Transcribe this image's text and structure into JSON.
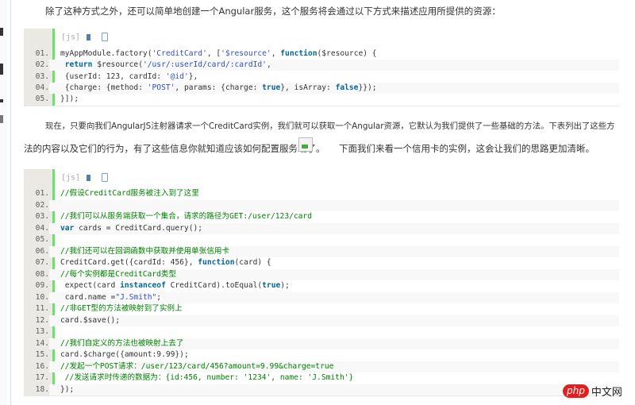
{
  "paragraphs": {
    "intro": "除了这种方式之外，还可以简单地创建一个Angular服务，这个服务将会通过以下方式来描述应用所提供的资源：",
    "second_line1": "现在，只要向我们AngularJS注射器请求一个CreditCard实例，我们就可以获取一个Angular资源，它默认为我们提供了一些基础的方法。下表列出了这些方",
    "second_line2a": "法的内容以及它们的行为，有了这些信息你就知道应该如何配置服务端了。",
    "second_line2b": "下面我们来看一个信用卡的实例，这会让我们的思路更加清晰。"
  },
  "code_blocks": [
    {
      "lang_label": "[js]",
      "lines": [
        {
          "n": "01.",
          "tokens": [
            [
              "",
              "myAppModule.factory("
            ],
            [
              "s",
              "'CreditCard'"
            ],
            [
              "",
              ", ["
            ],
            [
              "s",
              "'$resource'"
            ],
            [
              "",
              ", "
            ],
            [
              "k",
              "function"
            ],
            [
              "",
              "($resource) {"
            ]
          ]
        },
        {
          "n": "02.",
          "tokens": [
            [
              "",
              " "
            ],
            [
              "k",
              "return"
            ],
            [
              "",
              " $resource("
            ],
            [
              "s",
              "'/usr/:userId/card/:cardId'"
            ],
            [
              "",
              ","
            ]
          ]
        },
        {
          "n": "03.",
          "tokens": [
            [
              "",
              "",
              " "
            ],
            [
              "",
              ""
            ],
            [
              "",
              "{userId: 123, cardId: "
            ],
            [
              "s",
              "'@id'"
            ],
            [
              "",
              "},"
            ]
          ]
        },
        {
          "n": "04.",
          "tokens": [
            [
              "",
              "",
              " "
            ],
            [
              "",
              "{charge: {method: "
            ],
            [
              "s",
              "'POST'"
            ],
            [
              "",
              ", params: {charge: "
            ],
            [
              "k",
              "true"
            ],
            [
              "",
              "}, isArray: "
            ],
            [
              "k",
              "false"
            ],
            [
              "",
              "}});"
            ]
          ]
        },
        {
          "n": "05.",
          "tokens": [
            [
              "",
              "}]);"
            ]
          ]
        }
      ]
    },
    {
      "lang_label": "[js]",
      "lines": [
        {
          "n": "01.",
          "tokens": [
            [
              "c",
              "//假设CreditCard服务被注入到了这里"
            ]
          ]
        },
        {
          "n": "02.",
          "tokens": []
        },
        {
          "n": "03.",
          "tokens": [
            [
              "c",
              "//我们可以从服务端获取一个集合，请求的路径为GET:/user/123/card"
            ]
          ]
        },
        {
          "n": "04.",
          "tokens": [
            [
              "k",
              "var"
            ],
            [
              "",
              " cards = CreditCard.query();"
            ]
          ]
        },
        {
          "n": "05.",
          "tokens": []
        },
        {
          "n": "06.",
          "tokens": [
            [
              "c",
              "//我们还可以在回调函数中获取并使用单张信用卡"
            ]
          ]
        },
        {
          "n": "07.",
          "tokens": [
            [
              "",
              "CreditCard.get({cardId: 456}, "
            ],
            [
              "k",
              "function"
            ],
            [
              "",
              "(card) {"
            ]
          ]
        },
        {
          "n": "08.",
          "tokens": [
            [
              "c",
              "//每个实例都是CreditCard类型"
            ]
          ]
        },
        {
          "n": "09.",
          "tokens": [
            [
              "",
              " expect(card "
            ],
            [
              "k",
              "instanceof"
            ],
            [
              "",
              " CreditCard).toEqual("
            ],
            [
              "k",
              "true"
            ],
            [
              "",
              ");"
            ]
          ]
        },
        {
          "n": "10.",
          "tokens": [
            [
              "",
              " card.name ="
            ],
            [
              "s",
              "\"J.Smith\""
            ],
            [
              "",
              ";"
            ]
          ]
        },
        {
          "n": "11.",
          "tokens": [
            [
              "c",
              "//非GET型的方法被映射到了实例上"
            ]
          ]
        },
        {
          "n": "12.",
          "tokens": [
            [
              "",
              "card.$save();"
            ]
          ]
        },
        {
          "n": "13.",
          "tokens": []
        },
        {
          "n": "14.",
          "tokens": [
            [
              "c",
              "//我们自定义的方法也被映射上去了"
            ]
          ]
        },
        {
          "n": "15.",
          "tokens": [
            [
              "",
              "card.$charge({amount:9.99});"
            ]
          ]
        },
        {
          "n": "16.",
          "tokens": [
            [
              "c",
              "//发起一个POST请求：/user/123/card/456?amount=9.99&charge=true"
            ]
          ]
        },
        {
          "n": "17.",
          "tokens": [
            [
              "c",
              " //发送请求时传递的数据为：{id:456, number: '1234', name: 'J.Smith'}"
            ]
          ]
        },
        {
          "n": "18.",
          "tokens": [
            [
              "",
              "});"
            ]
          ]
        }
      ]
    }
  ],
  "logo": {
    "php": "php",
    "cn": "中文网"
  },
  "colors": {
    "keyword": "#006699",
    "string": "#3050c0",
    "comment": "#008200",
    "gutter_bar": "#6ce26c"
  }
}
